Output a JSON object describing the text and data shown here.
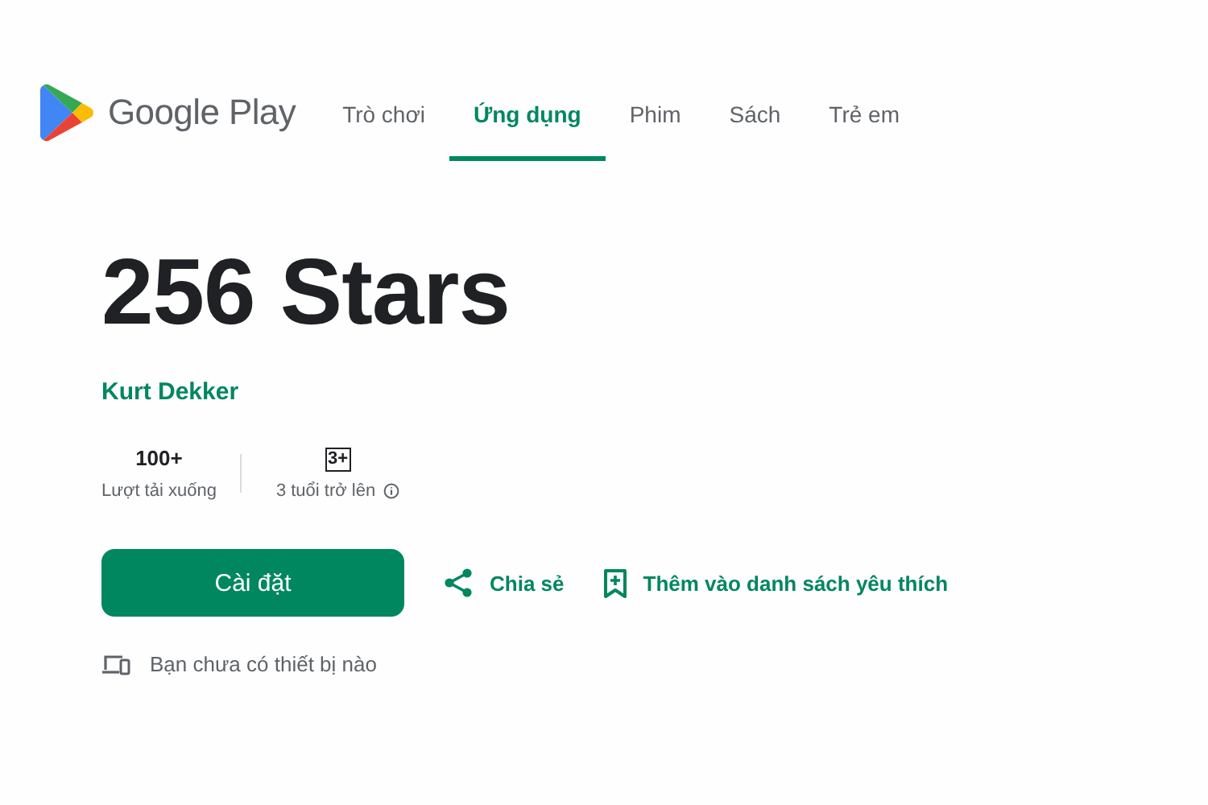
{
  "header": {
    "logo_text": "Google Play",
    "tabs": [
      {
        "label": "Trò chơi",
        "selected": false
      },
      {
        "label": "Ứng dụng",
        "selected": true
      },
      {
        "label": "Phim",
        "selected": false
      },
      {
        "label": "Sách",
        "selected": false
      },
      {
        "label": "Trẻ em",
        "selected": false
      }
    ]
  },
  "app": {
    "title": "256 Stars",
    "developer": "Kurt Dekker",
    "stats": [
      {
        "kind": "count",
        "value": "100+",
        "label": "Lượt tải xuống"
      },
      {
        "kind": "rating",
        "value": "3+",
        "label": "3 tuổi trở lên"
      }
    ],
    "install_button": "Cài đặt",
    "share_button": "Chia sẻ",
    "wishlist_button": "Thêm vào danh sách yêu thích",
    "device_note": "Bạn chưa có thiết bị nào"
  }
}
